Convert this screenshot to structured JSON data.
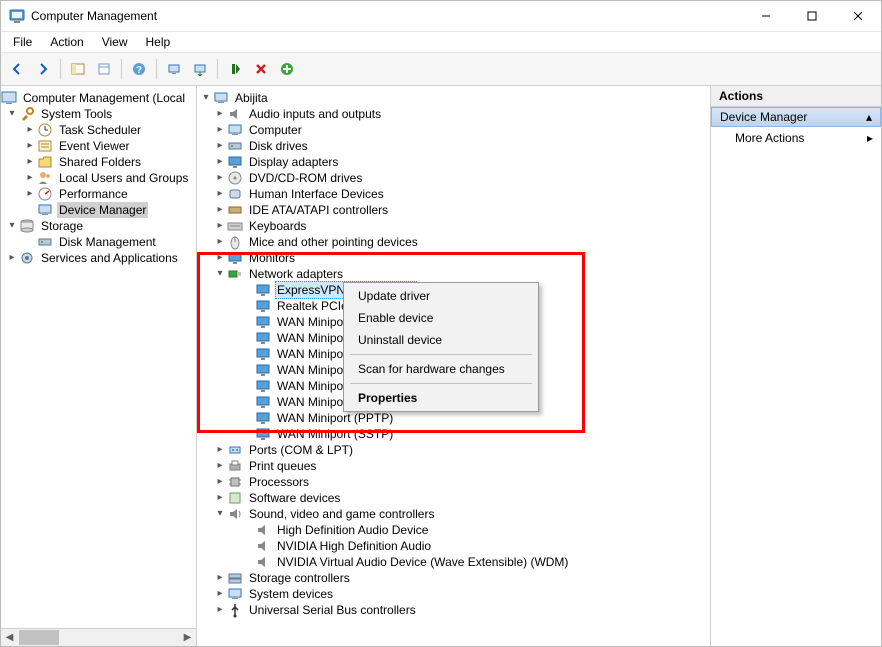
{
  "title": "Computer Management",
  "menubar": [
    "File",
    "Action",
    "View",
    "Help"
  ],
  "actions_pane": {
    "header": "Actions",
    "selected": "Device Manager",
    "more": "More Actions"
  },
  "left_tree": {
    "root": "Computer Management (Local",
    "system_tools": {
      "label": "System Tools",
      "children": [
        "Task Scheduler",
        "Event Viewer",
        "Shared Folders",
        "Local Users and Groups",
        "Performance",
        "Device Manager"
      ]
    },
    "storage": {
      "label": "Storage",
      "children": [
        "Disk Management"
      ]
    },
    "services": "Services and Applications"
  },
  "device_tree": {
    "root": "Abijita",
    "categories_before": [
      "Audio inputs and outputs",
      "Computer",
      "Disk drives",
      "Display adapters",
      "DVD/CD-ROM drives",
      "Human Interface Devices",
      "IDE ATA/ATAPI controllers",
      "Keyboards",
      "Mice and other pointing devices",
      "Monitors"
    ],
    "network": {
      "label": "Network adapters",
      "children": [
        "ExpressVPN TAP Adapter",
        "Realtek PCIe GbE",
        "WAN Miniport (IKEv2)",
        "WAN Miniport (IP)",
        "WAN Miniport (IPv6)",
        "WAN Miniport (L2TP)",
        "WAN Miniport (Network Monitor)",
        "WAN Miniport (PPPOE)",
        "WAN Miniport (PPTP)",
        "WAN Miniport (SSTP)"
      ]
    },
    "categories_mid": [
      "Ports (COM & LPT)",
      "Print queues",
      "Processors",
      "Software devices"
    ],
    "sound": {
      "label": "Sound, video and game controllers",
      "children": [
        "High Definition Audio Device",
        "NVIDIA High Definition Audio",
        "NVIDIA Virtual Audio Device (Wave Extensible) (WDM)"
      ]
    },
    "categories_after": [
      "Storage controllers",
      "System devices",
      "Universal Serial Bus controllers"
    ]
  },
  "context_menu": {
    "items": [
      "Update driver",
      "Enable device",
      "Uninstall device"
    ],
    "scan": "Scan for hardware changes",
    "properties": "Properties"
  }
}
